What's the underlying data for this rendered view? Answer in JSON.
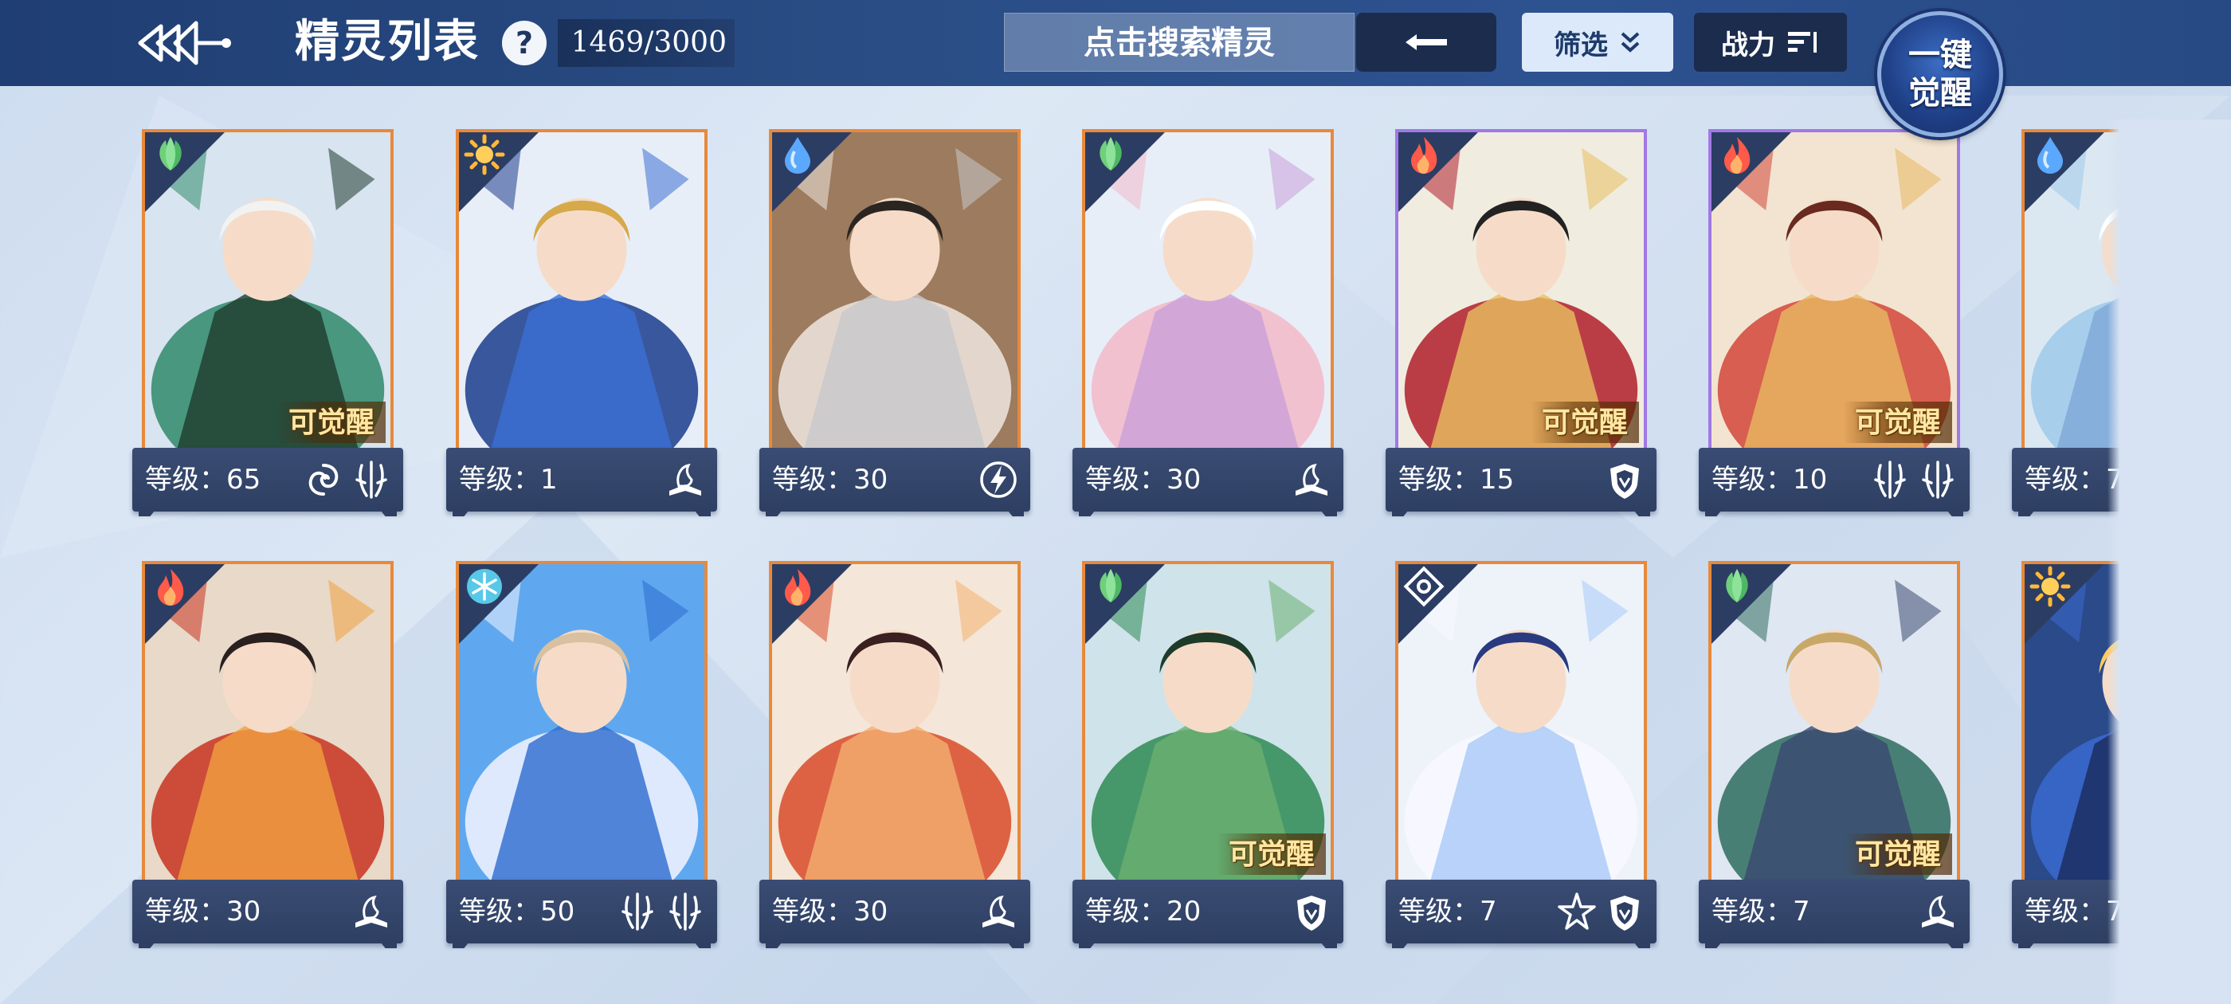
{
  "header": {
    "title": "精灵列表",
    "help": "?",
    "count": "1469/3000",
    "search_placeholder": "点击搜索精灵",
    "filter_label": "筛选",
    "sort_label": "战力",
    "awaken_line1": "一键",
    "awaken_line2": "觉醒"
  },
  "colors": {
    "header_bg": "#2a4d85",
    "card_border_orange": "#e8893a",
    "card_border_purple": "#a178e6",
    "footer_bg": "#2e3f63"
  },
  "level_prefix": "等级：",
  "awaken_tag": "可觉醒",
  "rows": [
    [
      {
        "level": "65",
        "element": "grass-icon",
        "awaken": true,
        "border": "orange",
        "skills": [
          "vortex-icon",
          "claw-icon"
        ]
      },
      {
        "level": "1",
        "element": "light-icon",
        "awaken": false,
        "border": "orange",
        "skills": [
          "book-icon"
        ]
      },
      {
        "level": "30",
        "element": "water-icon",
        "awaken": false,
        "border": "orange",
        "skills": [
          "lightning-icon"
        ]
      },
      {
        "level": "30",
        "element": "grass-icon",
        "awaken": false,
        "border": "orange",
        "skills": [
          "book-icon"
        ]
      },
      {
        "level": "15",
        "element": "fire-icon",
        "awaken": true,
        "border": "purple",
        "skills": [
          "shield-icon"
        ]
      },
      {
        "level": "10",
        "element": "fire-icon",
        "awaken": true,
        "border": "purple",
        "skills": [
          "claw-icon",
          "claw-icon"
        ]
      },
      {
        "level": "7",
        "element": "water-icon",
        "awaken": false,
        "border": "orange",
        "skills": []
      }
    ],
    [
      {
        "level": "30",
        "element": "fire-icon",
        "awaken": false,
        "border": "orange",
        "skills": [
          "book-icon"
        ]
      },
      {
        "level": "50",
        "element": "ice-icon",
        "awaken": false,
        "border": "orange",
        "skills": [
          "claw-icon",
          "claw-icon"
        ]
      },
      {
        "level": "30",
        "element": "fire-icon",
        "awaken": false,
        "border": "orange",
        "skills": [
          "book-icon"
        ]
      },
      {
        "level": "20",
        "element": "grass-icon",
        "awaken": true,
        "border": "orange",
        "skills": [
          "shield-icon"
        ]
      },
      {
        "level": "7",
        "element": "mechanical-icon",
        "awaken": false,
        "border": "orange",
        "skills": [
          "star-icon",
          "shield-icon"
        ]
      },
      {
        "level": "7",
        "element": "grass-icon",
        "awaken": true,
        "border": "orange",
        "skills": [
          "book-icon"
        ]
      },
      {
        "level": "7",
        "element": "light-icon",
        "awaken": false,
        "border": "orange",
        "skills": []
      }
    ]
  ]
}
